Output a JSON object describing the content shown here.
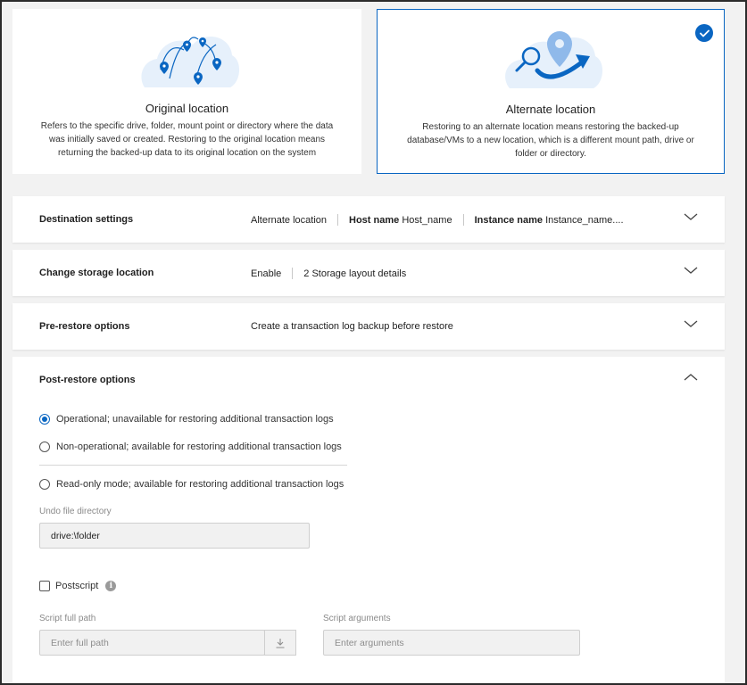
{
  "cards": [
    {
      "title": "Original location",
      "description": "Refers to the specific drive, folder, mount point or directory where the data was initially saved or created. Restoring to the original location means returning the backed-up data to its original location on the system",
      "selected": false
    },
    {
      "title": "Alternate location",
      "description": "Restoring to an alternate location means restoring the backed-up database/VMs to a new location, which is a different mount path, drive or folder or directory.",
      "selected": true
    }
  ],
  "sections": {
    "destination": {
      "label": "Destination settings",
      "location": "Alternate location",
      "host_key": "Host name",
      "host_value": "Host_name",
      "instance_key": "Instance name",
      "instance_value": "Instance_name...."
    },
    "storage": {
      "label": "Change storage location",
      "status": "Enable",
      "details": "2 Storage layout details"
    },
    "pre_restore": {
      "label": "Pre-restore options",
      "summary": "Create a transaction log backup before restore"
    },
    "post_restore": {
      "label": "Post-restore options",
      "options": [
        {
          "label": "Operational; unavailable for restoring additional transaction logs",
          "selected": true
        },
        {
          "label": "Non-operational; available for restoring additional transaction logs",
          "selected": false
        },
        {
          "label": "Read-only mode; available for restoring additional transaction logs",
          "selected": false
        }
      ],
      "undo_label": "Undo file directory",
      "undo_value": "drive:\\folder",
      "postscript_label": "Postscript",
      "postscript_checked": false,
      "script_path_label": "Script full path",
      "script_path_placeholder": "Enter full path",
      "script_args_label": "Script arguments",
      "script_args_placeholder": "Enter arguments"
    }
  },
  "colors": {
    "accent": "#0a66c2",
    "background": "#f2f2f2"
  },
  "icons": {
    "selected": "checkmark-icon",
    "collapse": "chevron-down-icon",
    "expand": "chevron-up-icon",
    "info": "info-icon",
    "download": "download-icon"
  }
}
